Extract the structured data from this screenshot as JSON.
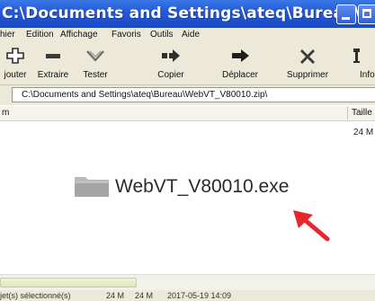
{
  "window": {
    "title": "C:\\Documents and Settings\\ateq\\Bureau\\W..."
  },
  "menu": {
    "items": [
      "hier",
      "Edition",
      "Affichage",
      "Favoris",
      "Outils",
      "Aide"
    ]
  },
  "toolbar": {
    "tools": [
      {
        "label": "jouter",
        "icon": "add-icon"
      },
      {
        "label": "Extraire",
        "icon": "extract-icon"
      },
      {
        "label": "Tester",
        "icon": "test-icon"
      },
      {
        "label": "Copier",
        "icon": "copy-arrow-icon"
      },
      {
        "label": "Déplacer",
        "icon": "move-arrow-icon"
      },
      {
        "label": "Supprimer",
        "icon": "delete-icon"
      },
      {
        "label": "Inform",
        "icon": "info-icon"
      }
    ]
  },
  "address": {
    "value": "C:\\Documents and Settings\\ateq\\Bureau\\WebVT_V80010.zip\\"
  },
  "columns": {
    "name": "m",
    "size": "Taille"
  },
  "files": [
    {
      "name": "WebVT_V80010.exe",
      "size": "24 M",
      "icon": "folder-icon"
    }
  ],
  "status": {
    "selection": "jet(s) sélectionné(s)",
    "size": "24 M",
    "packed": "24 M",
    "date": "2017-05-19 14:09"
  },
  "colors": {
    "titlebar": "#245ad8",
    "annotation_arrow": "#e8262b"
  }
}
